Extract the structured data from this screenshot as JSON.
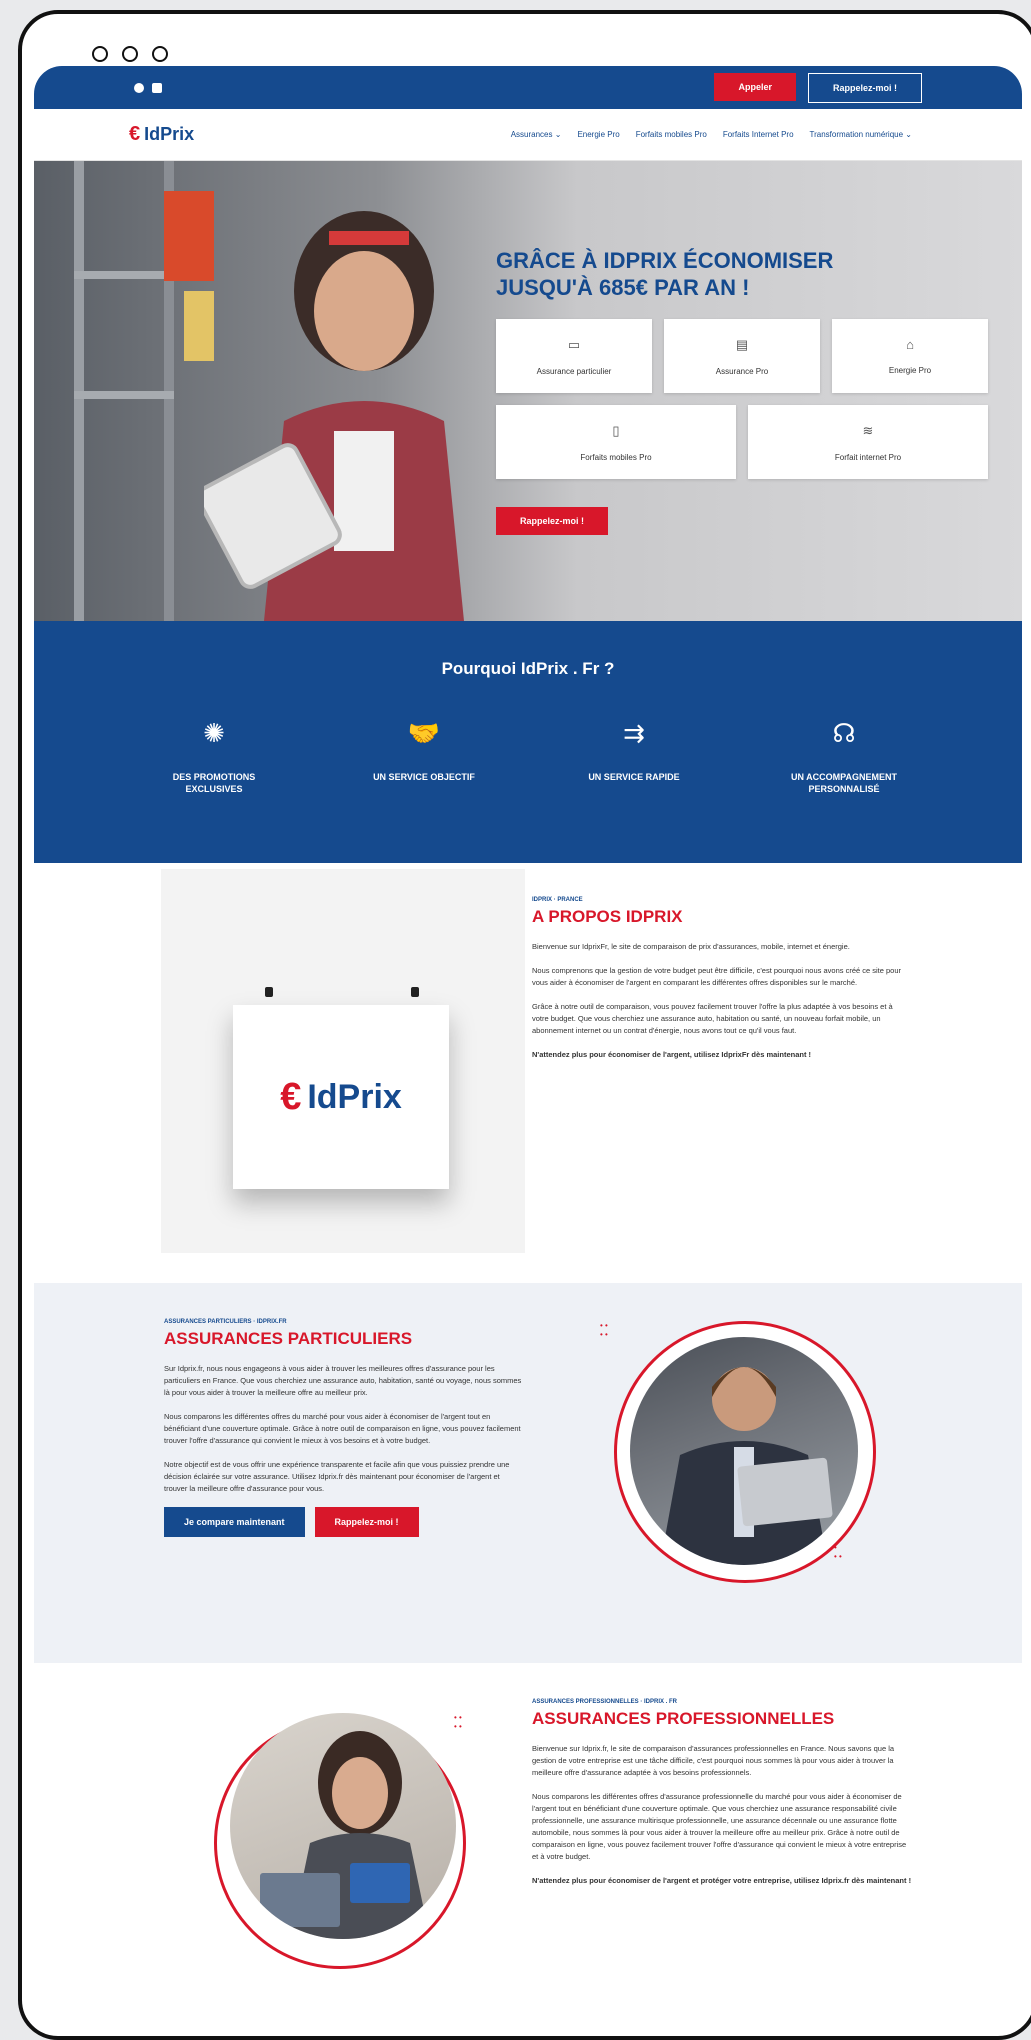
{
  "topbar": {
    "social": [
      "facebook-icon",
      "instagram-icon"
    ],
    "buttons": [
      {
        "label": "Appeler"
      },
      {
        "label": "Rappelez-moi !"
      }
    ]
  },
  "navbar": {
    "logo_text": "IdPrix",
    "items": [
      "Assurances",
      "Energie Pro",
      "Forfaits mobiles Pro",
      "Forfaits Internet Pro",
      "Transformation numérique"
    ]
  },
  "hero": {
    "title": "GRÂCE À IDPRIX ÉCONOMISER JUSQU'À 685€ PAR AN !",
    "cards_row1": [
      {
        "icon": "document-icon",
        "label": "Assurance particulier"
      },
      {
        "icon": "clipboard-icon",
        "label": "Assurance Pro"
      },
      {
        "icon": "energy-icon",
        "label": "Energie Pro"
      }
    ],
    "cards_row2": [
      {
        "icon": "phone-icon",
        "label": "Forfaits mobiles Pro"
      },
      {
        "icon": "wifi-icon",
        "label": "Forfait internet Pro"
      }
    ],
    "cta_label": "Rappelez-moi !"
  },
  "why": {
    "title": "Pourquoi IdPrix . Fr ?",
    "features": [
      {
        "icon": "promotion-icon",
        "label": "DES PROMOTIONS EXCLUSIVES"
      },
      {
        "icon": "handshake-icon",
        "label": "UN SERVICE OBJECTIF"
      },
      {
        "icon": "speed-icon",
        "label": "UN SERVICE RAPIDE"
      },
      {
        "icon": "support-icon",
        "label": "UN ACCOMPAGNEMENT PERSONNALISÉ"
      }
    ]
  },
  "about": {
    "sign_text": "IdPrix",
    "eyebrow": "IDPRIX · PRANCE",
    "title": "A PROPOS IDPRIX",
    "paragraphs": [
      "Bienvenue sur IdprixFr, le site de comparaison de prix d'assurances, mobile, internet et énergie.",
      "Nous comprenons que la gestion de votre budget peut être difficile, c'est pourquoi nous avons créé ce site pour vous aider à économiser de l'argent en comparant les différentes offres disponibles sur le marché.",
      "Grâce à notre outil de comparaison, vous pouvez facilement trouver l'offre la plus adaptée à vos besoins et à votre budget. Que vous cherchiez une assurance auto, habitation ou santé, un nouveau forfait mobile, un abonnement internet ou un contrat d'énergie, nous avons tout ce qu'il vous faut.",
      "N'attendez plus pour économiser de l'argent, utilisez IdprixFr dès maintenant !"
    ]
  },
  "particuliers": {
    "eyebrow": "ASSURANCES PARTICULIERS · IDPRIX.FR",
    "title": "ASSURANCES PARTICULIERS",
    "paragraphs": [
      "Sur Idprix.fr, nous nous engageons à vous aider à trouver les meilleures offres d'assurance pour les particuliers en France. Que vous cherchiez une assurance auto, habitation, santé ou voyage, nous sommes là pour vous aider à trouver la meilleure offre au meilleur prix.",
      "Nous comparons les différentes offres du marché pour vous aider à économiser de l'argent tout en bénéficiant d'une couverture optimale. Grâce à notre outil de comparaison en ligne, vous pouvez facilement trouver l'offre d'assurance qui convient le mieux à vos besoins et à votre budget.",
      "Notre objectif est de vous offrir une expérience transparente et facile afin que vous puissiez prendre une décision éclairée sur votre assurance. Utilisez Idprix.fr dès maintenant pour économiser de l'argent et trouver la meilleure offre d'assurance pour vous."
    ],
    "buttons": [
      {
        "label": "Je compare maintenant"
      },
      {
        "label": "Rappelez-moi !"
      }
    ]
  },
  "pro": {
    "eyebrow": "ASSURANCES PROFESSIONNELLES · IDPRIX . FR",
    "title": "ASSURANCES PROFESSIONNELLES",
    "paragraphs": [
      "Bienvenue sur Idprix.fr, le site de comparaison d'assurances professionnelles en France. Nous savons que la gestion de votre entreprise est une tâche difficile, c'est pourquoi nous sommes là pour vous aider à trouver la meilleure offre d'assurance adaptée à vos besoins professionnels.",
      "Nous comparons les différentes offres d'assurance professionnelle du marché pour vous aider à économiser de l'argent tout en bénéficiant d'une couverture optimale. Que vous cherchiez une assurance responsabilité civile professionnelle, une assurance multirisque professionnelle, une assurance décennale ou une assurance flotte automobile, nous sommes là pour vous aider à trouver la meilleure offre au meilleur prix. Grâce à notre outil de comparaison en ligne, vous pouvez facilement trouver l'offre d'assurance qui convient le mieux à votre entreprise et à votre budget.",
      "N'attendez plus pour économiser de l'argent et protéger votre entreprise, utilisez Idprix.fr dès maintenant !"
    ]
  },
  "colors": {
    "brand_blue": "#154a8e",
    "brand_red": "#d8172a"
  }
}
